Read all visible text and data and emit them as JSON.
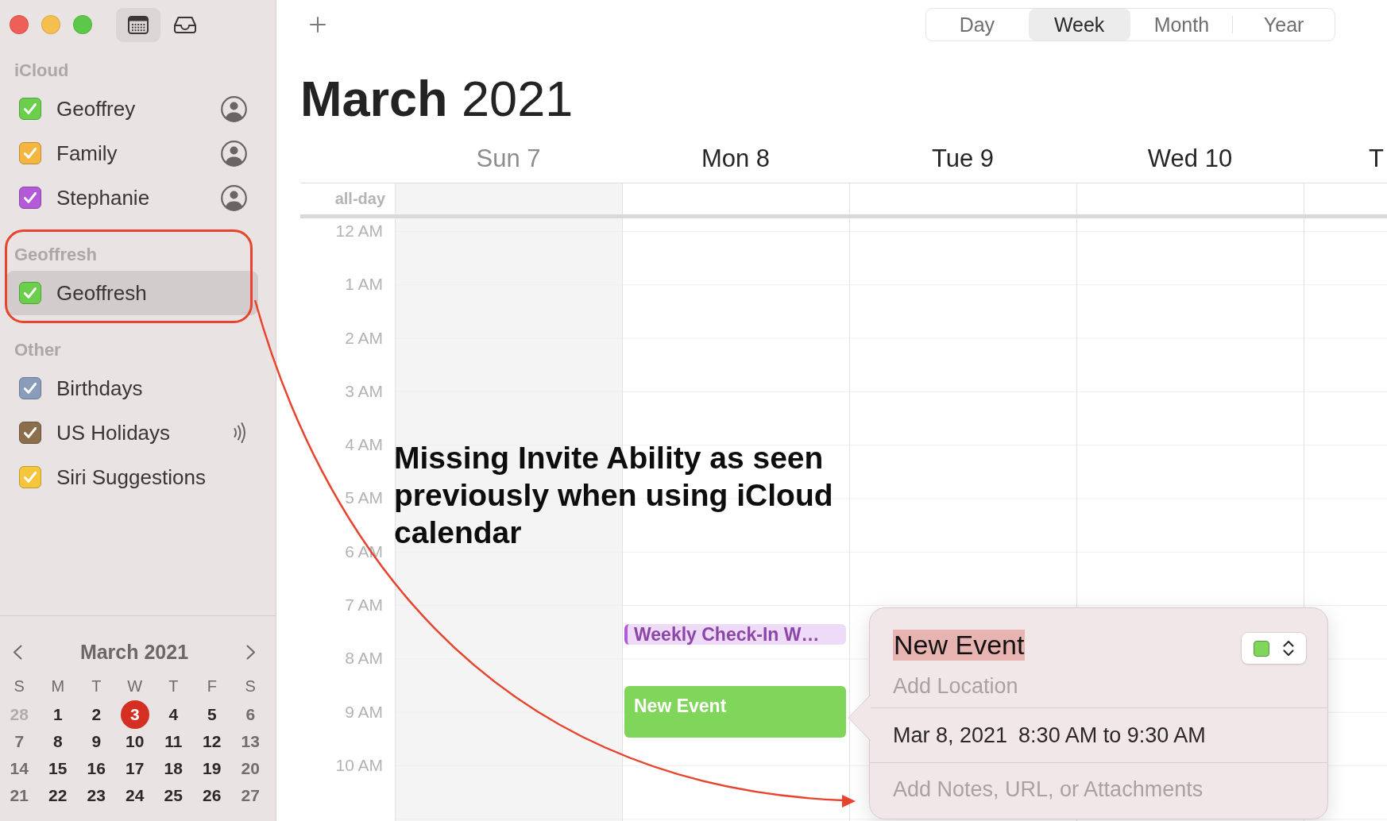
{
  "toolbar": {
    "buttons": [
      {
        "kind": "calendars",
        "selected": true
      },
      {
        "kind": "inbox",
        "selected": false
      }
    ]
  },
  "sidebar": {
    "groups": [
      {
        "title": "iCloud",
        "items": [
          {
            "name": "Geoffrey",
            "kind": "shared",
            "color": "#6ccf4c",
            "checked": true,
            "selected": false
          },
          {
            "name": "Family",
            "kind": "shared",
            "color": "#f4b640",
            "checked": true,
            "selected": false
          },
          {
            "name": "Stephanie",
            "kind": "shared",
            "color": "#b35ad9",
            "checked": true,
            "selected": false
          }
        ]
      },
      {
        "title": "Geoffresh",
        "items": [
          {
            "name": "Geoffresh",
            "kind": "local",
            "color": "#6ccf4c",
            "checked": true,
            "selected": true
          }
        ]
      },
      {
        "title": "Other",
        "items": [
          {
            "name": "Birthdays",
            "kind": "local",
            "color": "#8a9cbb",
            "checked": true,
            "selected": false
          },
          {
            "name": "US Holidays",
            "kind": "subscribed",
            "color": "#8b6e4c",
            "checked": true,
            "selected": false
          },
          {
            "name": "Siri Suggestions",
            "kind": "local",
            "color": "#f5c53e",
            "checked": true,
            "selected": false
          }
        ]
      }
    ]
  },
  "mini_calendar": {
    "title": "March 2021",
    "weekdays": [
      "S",
      "M",
      "T",
      "W",
      "T",
      "F",
      "S"
    ],
    "weeks": [
      [
        {
          "label": "28",
          "in_month": false,
          "today": false
        },
        {
          "label": "1",
          "in_month": true,
          "today": false
        },
        {
          "label": "2",
          "in_month": true,
          "today": false
        },
        {
          "label": "3",
          "in_month": true,
          "today": true
        },
        {
          "label": "4",
          "in_month": true,
          "today": false
        },
        {
          "label": "5",
          "in_month": true,
          "today": false
        },
        {
          "label": "6",
          "in_month": true,
          "today": false
        }
      ],
      [
        {
          "label": "7",
          "in_month": true,
          "today": false
        },
        {
          "label": "8",
          "in_month": true,
          "today": false
        },
        {
          "label": "9",
          "in_month": true,
          "today": false
        },
        {
          "label": "10",
          "in_month": true,
          "today": false
        },
        {
          "label": "11",
          "in_month": true,
          "today": false
        },
        {
          "label": "12",
          "in_month": true,
          "today": false
        },
        {
          "label": "13",
          "in_month": true,
          "today": false
        }
      ],
      [
        {
          "label": "14",
          "in_month": true,
          "today": false
        },
        {
          "label": "15",
          "in_month": true,
          "today": false
        },
        {
          "label": "16",
          "in_month": true,
          "today": false
        },
        {
          "label": "17",
          "in_month": true,
          "today": false
        },
        {
          "label": "18",
          "in_month": true,
          "today": false
        },
        {
          "label": "19",
          "in_month": true,
          "today": false
        },
        {
          "label": "20",
          "in_month": true,
          "today": false
        }
      ],
      [
        {
          "label": "21",
          "in_month": true,
          "today": false
        },
        {
          "label": "22",
          "in_month": true,
          "today": false
        },
        {
          "label": "23",
          "in_month": true,
          "today": false
        },
        {
          "label": "24",
          "in_month": true,
          "today": false
        },
        {
          "label": "25",
          "in_month": true,
          "today": false
        },
        {
          "label": "26",
          "in_month": true,
          "today": false
        },
        {
          "label": "27",
          "in_month": true,
          "today": false
        }
      ]
    ]
  },
  "views": [
    {
      "label": "Day",
      "selected": false
    },
    {
      "label": "Week",
      "selected": true
    },
    {
      "label": "Month",
      "selected": false
    },
    {
      "label": "Year",
      "selected": false
    }
  ],
  "title": "**March** 2021",
  "week": {
    "all_day_label": "all-day",
    "hours": [
      "12 AM",
      "1 AM",
      "2 AM",
      "3 AM",
      "4 AM",
      "5 AM",
      "6 AM",
      "7 AM",
      "8 AM",
      "9 AM",
      "10 AM"
    ],
    "days": [
      {
        "label": "Sun 7",
        "weekend": true
      },
      {
        "label": "Mon 8",
        "weekend": false,
        "events": [
          {
            "title": "Weekly Check-In W…",
            "color": "#b35ad9",
            "selected": false
          },
          {
            "title": "New Event",
            "color": "#80d65a",
            "selected": true
          }
        ]
      },
      {
        "label": "Tue 9",
        "weekend": false
      },
      {
        "label": "Wed 10",
        "weekend": false
      },
      {
        "label": "T",
        "weekend": false
      }
    ]
  },
  "popover": {
    "title": {
      "value": "New Event",
      "highlighted": true
    },
    "location": {
      "placeholder": "Add Location"
    },
    "date": "Mar 8, 2021",
    "time": "8:30 AM to 9:30 AM",
    "notes": {
      "placeholder": "Add Notes, URL, or Attachments"
    }
  },
  "annotation": {
    "text": "Missing Invite Ability as seen previously when using iCloud calendar"
  }
}
